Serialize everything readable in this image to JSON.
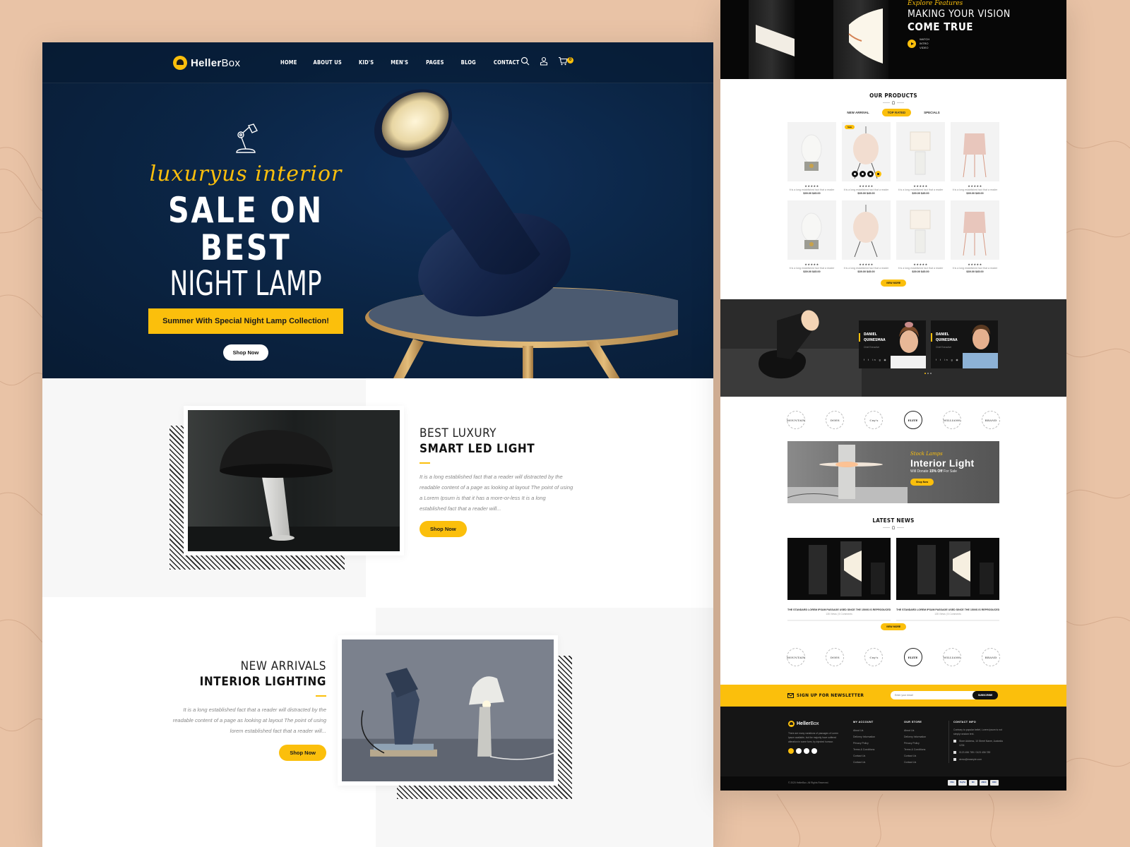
{
  "brand": {
    "name_bold": "Heller",
    "name_light": "Box",
    "accent_color": "#fbbf0c",
    "navy_color": "#0b2545"
  },
  "nav": {
    "links": [
      "HOME",
      "ABOUT US",
      "KID'S",
      "MEN'S",
      "PAGES",
      "BLOG",
      "CONTACT"
    ],
    "icons": [
      "search-icon",
      "user-icon",
      "cart-icon"
    ],
    "cart_count": "0"
  },
  "hero": {
    "icon": "desk-lamp-icon",
    "script": "luxuryus interior",
    "title_bold": "SALE ON BEST",
    "title_light": "NIGHT LAMP",
    "ribbon": "Summer With Special Night Lamp Collection!",
    "cta": "Shop Now"
  },
  "feature_one": {
    "kicker": "BEST LUXURY",
    "title": "SMART LED LIGHT",
    "body": "It is a long established fact that a reader will distracted by the readable content of a page as looking at layout The point of using a Lorem Ipsum is that it has a more-or-less It is a long established fact that a reader will...",
    "cta": "Shop Now"
  },
  "feature_two": {
    "kicker": "NEW ARRIVALS",
    "title": "INTERIOR LIGHTING",
    "body": "It is a long established fact that a reader will distracted by the readable content of a page as looking at layout The point of using lorem established fact that a reader will...",
    "cta": "Shop Now"
  },
  "preview": {
    "hero": {
      "script": "Explore Features",
      "kicker": "MAKING YOUR VISION",
      "title": "COME TRUE",
      "play_label": "WATCH INTRO VIDEO"
    },
    "products": {
      "title": "OUR PRODUCTS",
      "tabs": [
        {
          "label": "NEW ARRIVAL",
          "active": false
        },
        {
          "label": "TOP RATED",
          "active": true
        },
        {
          "label": "SPECIALS",
          "active": false
        }
      ],
      "sale_badge": "Sale",
      "items": [
        {
          "name": "It is a long established fact that a reader",
          "price": "$39.00 $45.00",
          "stars": "★★★★★",
          "kind": "egg"
        },
        {
          "name": "It is a long established fact that a reader",
          "price": "$39.00 $45.00",
          "stars": "★★★★★",
          "kind": "lantern",
          "sale": true,
          "hover": true
        },
        {
          "name": "It is a long established fact that a reader",
          "price": "$39.00 $45.00",
          "stars": "★★★★★",
          "kind": "table"
        },
        {
          "name": "It is a long established fact that a reader",
          "price": "$39.00 $45.00",
          "stars": "★★★★★",
          "kind": "floor"
        },
        {
          "name": "It is a long established fact that a reader",
          "price": "$39.00 $45.00",
          "stars": "★★★★★",
          "kind": "egg"
        },
        {
          "name": "It is a long established fact that a reader",
          "price": "$39.00 $45.00",
          "stars": "★★★★★",
          "kind": "lantern"
        },
        {
          "name": "It is a long established fact that a reader",
          "price": "$39.00 $45.00",
          "stars": "★★★★★",
          "kind": "table"
        },
        {
          "name": "It is a long established fact that a reader",
          "price": "$39.00 $45.00",
          "stars": "★★★★★",
          "kind": "floor"
        }
      ],
      "view_more": "VIEW MORE"
    },
    "team": [
      {
        "name": "DANIEL QUINESMAA",
        "role": "Chief Executive",
        "social": "f  t  in  g  ◉"
      },
      {
        "name": "DANIEL QUINESMAA",
        "role": "Chief Executive",
        "social": "f  t  in  g  ◉"
      }
    ],
    "brands": [
      "MOUNTAIN",
      "DOES",
      "Cuy's",
      "ELITE",
      "WILLIAMS",
      "BRAND"
    ],
    "banner": {
      "script": "Stock Lamps",
      "title": "Interior Light",
      "sub_pre": "Will Donate ",
      "sub_bold": "15% Off",
      "sub_post": " For Sale",
      "cta": "Shop Now"
    },
    "news": {
      "title": "LATEST NEWS",
      "items": [
        {
          "title": "THE STANDARD LOREM IPSUM PASSAGE USED SINCE THE 1500S IS REPRODUCED",
          "meta": "135 Views   |   5 Comments"
        },
        {
          "title": "THE STANDARD LOREM IPSUM PASSAGE USED SINCE THE 1500S IS REPRODUCED",
          "meta": "135 Views   |   5 Comments"
        }
      ],
      "view_more": "VIEW MORE"
    },
    "newsletter": {
      "label": "SIGN UP FOR NEWSLETTER",
      "placeholder": "Enter your email",
      "button": "SUBSCRIBE"
    },
    "footer": {
      "about": "There are many variations of passages of Lorem Ipsum available, but the majority have suffered alteration in some form, by injected humour.",
      "my_account": {
        "heading": "MY ACCOUNT",
        "links": [
          "About Us",
          "Delivery Information",
          "Privacy Policy",
          "Terms & Conditions",
          "Contact Us",
          "Contact Us"
        ]
      },
      "our_store": {
        "heading": "OUR STORE",
        "links": [
          "About Us",
          "Delivery Information",
          "Privacy Policy",
          "Terms & Conditions",
          "Contact Us",
          "Contact Us"
        ]
      },
      "contact": {
        "heading": "CONTACT INFO",
        "intro": "Contrary to popular belief, Lorem Ipsum is not simply random text.",
        "address": "Store Address, 10 Street Name, Australia 1234",
        "phone": "0123 456 789 / 0123 456 789",
        "email": "demo@example.com"
      },
      "copyright": "© 2020 HellerBox. All Rights Reserved.",
      "payments": [
        "VISA",
        "PayPal",
        "MC",
        "AMEX",
        "DISC"
      ]
    }
  }
}
